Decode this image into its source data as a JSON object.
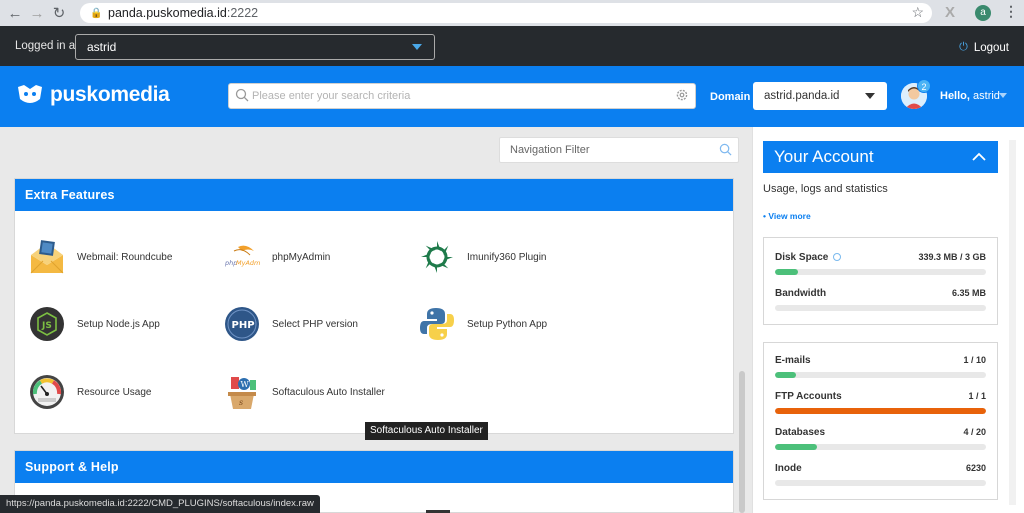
{
  "browser": {
    "url_host": "panda.puskomedia.id",
    "url_port": ":2222",
    "profile_initial": "a"
  },
  "login_bar": {
    "label": "Logged in as",
    "user": "astrid",
    "logout": "Logout"
  },
  "header": {
    "brand": "puskomedia",
    "search_placeholder": "Please enter your search criteria",
    "domain_label": "Domain",
    "domain_value": "astrid.panda.id",
    "notification_count": "2",
    "hello_prefix": "Hello,",
    "hello_user": "astrid"
  },
  "nav_filter": {
    "placeholder": "Navigation Filter"
  },
  "extra_features": {
    "title": "Extra Features",
    "items": [
      {
        "label": "Webmail: Roundcube",
        "icon": "roundcube-icon"
      },
      {
        "label": "phpMyAdmin",
        "icon": "phpmyadmin-icon"
      },
      {
        "label": "Imunify360 Plugin",
        "icon": "imunify360-icon"
      },
      {
        "label": "Setup Node.js App",
        "icon": "nodejs-icon"
      },
      {
        "label": "Select PHP version",
        "icon": "php-icon"
      },
      {
        "label": "Setup Python App",
        "icon": "python-icon"
      },
      {
        "label": "Resource Usage",
        "icon": "gauge-icon"
      },
      {
        "label": "Softaculous Auto Installer",
        "icon": "softaculous-icon"
      }
    ]
  },
  "tooltip": "Softaculous Auto Installer",
  "support": {
    "title": "Support & Help"
  },
  "status_url": "https://panda.puskomedia.id:2222/CMD_PLUGINS/softaculous/index.raw",
  "account": {
    "title": "Your Account",
    "subtitle": "Usage, logs and statistics",
    "view_more": "• View more",
    "stats_top": [
      {
        "name": "Disk Space",
        "value": "339.3 MB / 3 GB",
        "fill": 0.11,
        "color": "#4cc07a"
      },
      {
        "name": "Bandwidth",
        "value": "6.35 MB",
        "fill": 0.0,
        "color": "#4cc07a"
      }
    ],
    "stats_bottom": [
      {
        "name": "E-mails",
        "value": "1 / 10",
        "fill": 0.1,
        "color": "#4cc07a"
      },
      {
        "name": "FTP Accounts",
        "value": "1 / 1",
        "fill": 1.0,
        "color": "#e8620a"
      },
      {
        "name": "Databases",
        "value": "4 / 20",
        "fill": 0.2,
        "color": "#4cc07a"
      },
      {
        "name": "Inode",
        "value": "6230",
        "fill": 0.0,
        "color": "#4cc07a"
      }
    ]
  }
}
